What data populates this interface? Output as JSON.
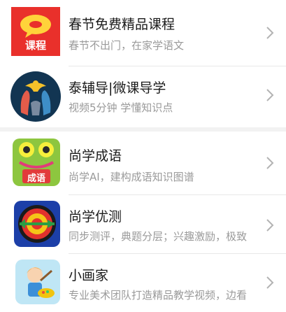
{
  "items": [
    {
      "title": "春节免费精品课程",
      "subtitle": "春节不出门，在家学语文",
      "icon": "red-chat-bubble-icon",
      "icon_label": "课程"
    },
    {
      "title": "泰辅导|微课导学",
      "subtitle": "视频5分钟 学懂知识点",
      "icon": "dove-hands-icon"
    },
    {
      "title": "尚学成语",
      "subtitle": "尚学AI，建构成语知识图谱",
      "icon": "frog-idiom-icon",
      "icon_label": "成语"
    },
    {
      "title": "尚学优测",
      "subtitle": "同步测评，典题分层；兴趣激励，极致",
      "icon": "target-arrow-icon"
    },
    {
      "title": "小画家",
      "subtitle": "专业美术团队打造精品教学视频，边看",
      "icon": "painter-boy-icon"
    }
  ],
  "colors": {
    "title": "#1a1a1a",
    "subtitle": "#9a9a9a",
    "chevron": "#b3b3b3"
  }
}
